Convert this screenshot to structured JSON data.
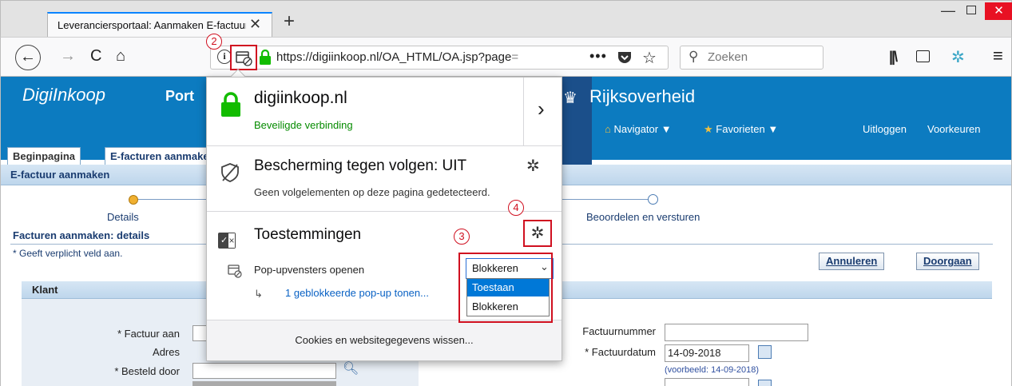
{
  "browser": {
    "tab_title": "Leveranciersportaal: Aanmaken E-factuur",
    "tab_close": "✕",
    "new_tab": "+",
    "url_main": "https://digiinkoop.nl/OA_HTML/OA.jsp?page",
    "url_fade": "=",
    "page_actions": "•••",
    "search_placeholder": "Zoeken",
    "icons": [
      "back-icon",
      "forward-icon",
      "reload-icon",
      "home-icon",
      "info-icon",
      "permission-blocked-icon",
      "lock-icon",
      "pocket-icon",
      "star-icon",
      "search-icon",
      "library-icon",
      "sidebar-icon",
      "extension-icon",
      "menu-icon"
    ]
  },
  "portal": {
    "brand": "DigiInkoop",
    "portal_word": "Port",
    "rijks_title": "Rijksoverheid",
    "nav_navigator": "Navigator ▼",
    "nav_favorieten": "Favorieten ▼",
    "nav_uitloggen": "Uitloggen",
    "nav_voorkeuren": "Voorkeuren",
    "tab_begin": "Beginpagina",
    "tab_efact": "E-facturen aanmaken",
    "section_title": "E-factuur aanmaken",
    "train_label_1": "Details",
    "train_label_2": "Beoordelen en versturen",
    "sub_title": "Facturen aanmaken: details",
    "required_note": "* Geeft verplicht veld aan.",
    "btn_annuleren": "Annuleren",
    "btn_doorgaan": "Doorgaan",
    "klant_title": "Klant",
    "lbl_factuur_aan": "* Factuur aan",
    "lbl_adres": "Adres",
    "lbl_besteld": "* Besteld door",
    "lbl_factuurnummer": "Factuurnummer",
    "lbl_factuurdatum": "* Factuurdatum",
    "val_factuurdatum": "14-09-2018",
    "date_example": "(voorbeeld: 14-09-2018)"
  },
  "panel": {
    "host": "digiinkoop.nl",
    "secure": "Beveiligde verbinding",
    "tracking_title": "Bescherming tegen volgen: UIT",
    "tracking_desc": "Geen volgelementen op deze pagina gedetecteerd.",
    "perms_title": "Toestemmingen",
    "popup_label": "Pop-upvensters openen",
    "popup_selected": "Blokkeren",
    "popup_options": [
      "Toestaan",
      "Blokkeren"
    ],
    "blocked_link": "1 geblokkeerde pop-up tonen...",
    "cookies_button": "Cookies en websitegegevens wissen..."
  },
  "markers": {
    "m2": "2",
    "m3": "3",
    "m4": "4"
  },
  "colors": {
    "accent": "#0a84ff",
    "portal_blue": "#0c7bc0",
    "secure_green": "#058b00",
    "highlight_red": "#d01020",
    "select_blue": "#0078d7"
  }
}
